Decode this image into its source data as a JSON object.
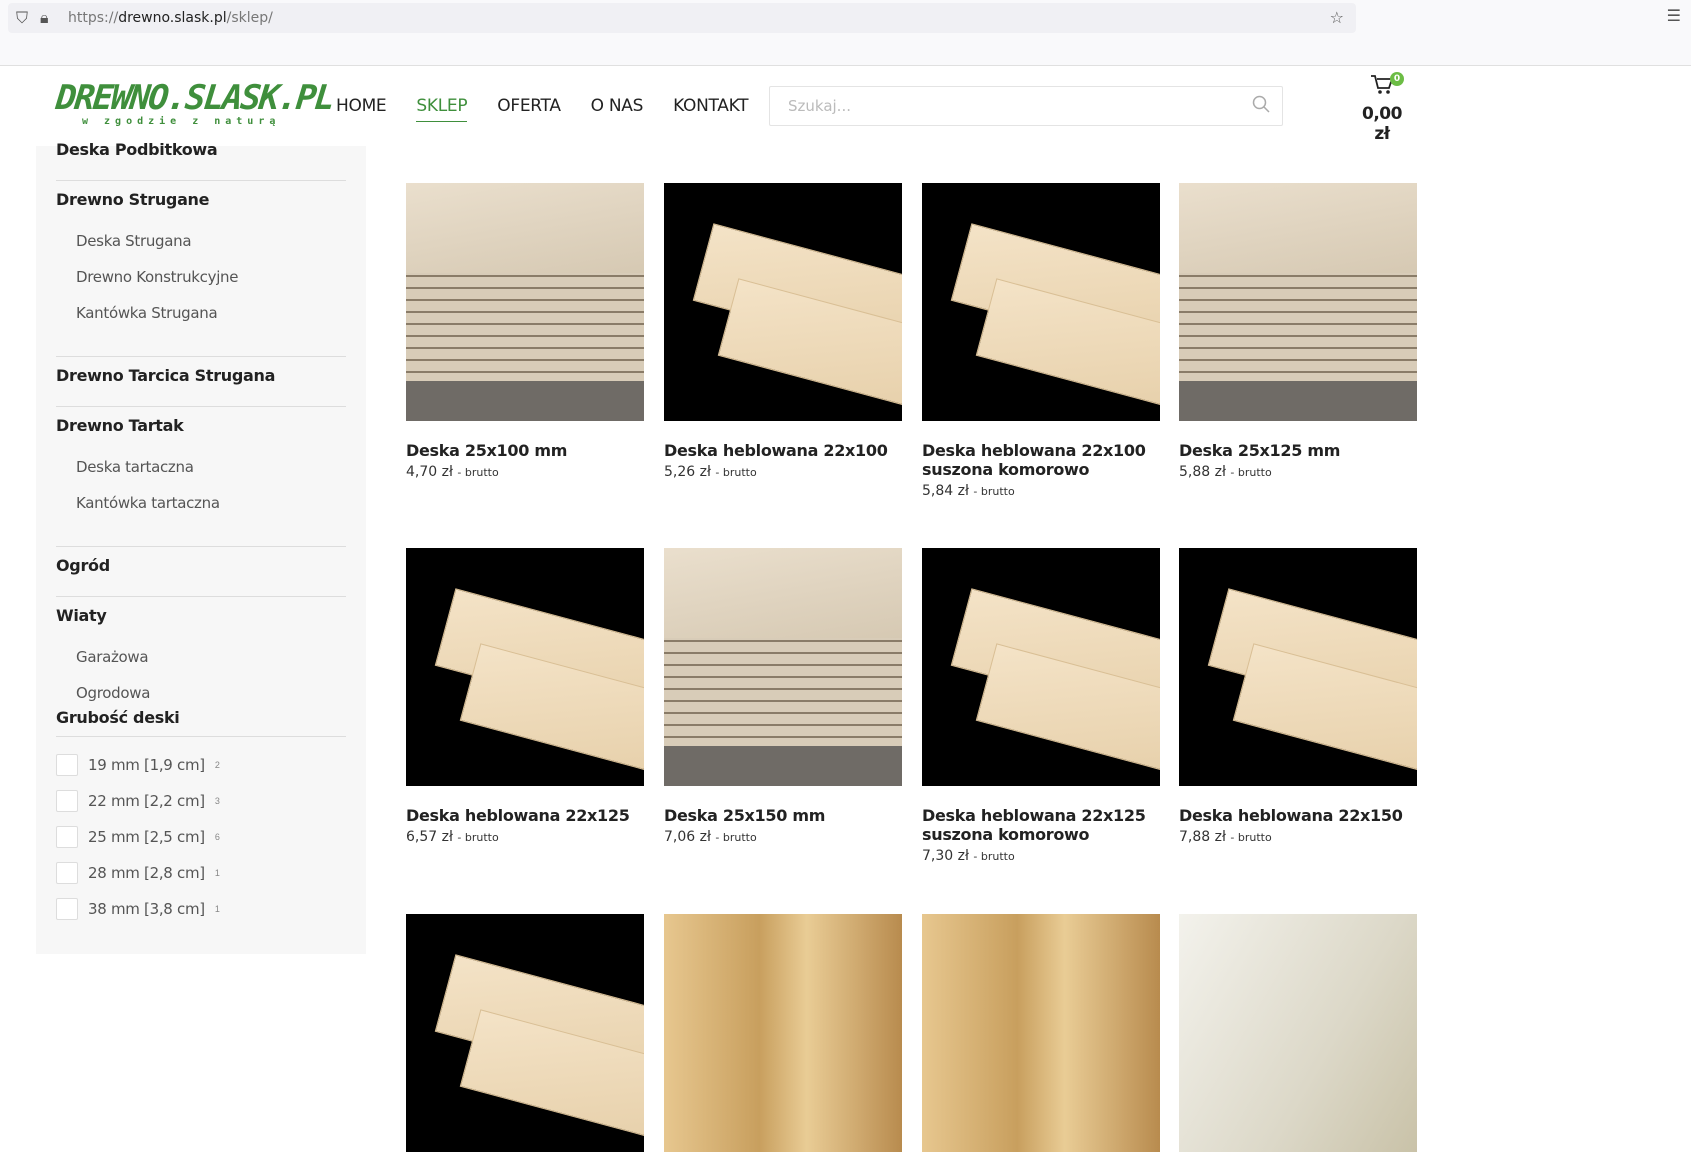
{
  "browser": {
    "url_scheme": "https://",
    "url_host": "drewno.slask.pl",
    "url_path": "/sklep/"
  },
  "header": {
    "logo_main": "DREWNO.SLASK.PL",
    "logo_tagline": "w zgodzie z naturą",
    "nav": [
      "HOME",
      "SKLEP",
      "OFERTA",
      "O NAS",
      "KONTAKT"
    ],
    "active_nav": "SKLEP",
    "search_placeholder": "Szukaj...",
    "cart_count": "0",
    "cart_total": "0,00 zł"
  },
  "sidebar": {
    "categories": [
      {
        "label": "Deska Podbitkowa",
        "subs": []
      },
      {
        "label": "Drewno Strugane",
        "subs": [
          "Deska Strugana",
          "Drewno Konstrukcyjne",
          "Kantówka Strugana"
        ]
      },
      {
        "label": "Drewno Tarcica Strugana",
        "subs": []
      },
      {
        "label": "Drewno Tartak",
        "subs": [
          "Deska tartaczna",
          "Kantówka tartaczna"
        ]
      },
      {
        "label": "Ogród",
        "subs": []
      },
      {
        "label": "Wiaty",
        "subs": [
          "Garażowa",
          "Ogrodowa"
        ]
      }
    ],
    "filter_title": "Grubość deski",
    "filters": [
      {
        "label": "19 mm [1,9 cm]",
        "count": "2"
      },
      {
        "label": "22 mm [2,2 cm]",
        "count": "3"
      },
      {
        "label": "25 mm [2,5 cm]",
        "count": "6"
      },
      {
        "label": "28 mm [2,8 cm]",
        "count": "1"
      },
      {
        "label": "38 mm [3,8 cm]",
        "count": "1"
      }
    ]
  },
  "products": [
    {
      "title": "Deska 25x100 mm",
      "price": "4,70 zł",
      "suffix": "- brutto",
      "image": "stack"
    },
    {
      "title": "Deska heblowana 22x100",
      "price": "5,26 zł",
      "suffix": "- brutto",
      "image": "black"
    },
    {
      "title": "Deska heblowana 22x100 suszona komorowo",
      "price": "5,84 zł",
      "suffix": "- brutto",
      "image": "black"
    },
    {
      "title": "Deska 25x125 mm",
      "price": "5,88 zł",
      "suffix": "- brutto",
      "image": "stack"
    },
    {
      "title": "Deska heblowana 22x125",
      "price": "6,57 zł",
      "suffix": "- brutto",
      "image": "black"
    },
    {
      "title": "Deska 25x150 mm",
      "price": "7,06 zł",
      "suffix": "- brutto",
      "image": "stack"
    },
    {
      "title": "Deska heblowana 22x125 suszona komorowo",
      "price": "7,30 zł",
      "suffix": "- brutto",
      "image": "black"
    },
    {
      "title": "Deska heblowana 22x150",
      "price": "7,88 zł",
      "suffix": "- brutto",
      "image": "black"
    },
    {
      "title": "",
      "price": "",
      "suffix": "",
      "image": "black"
    },
    {
      "title": "",
      "price": "",
      "suffix": "",
      "image": "wood"
    },
    {
      "title": "",
      "price": "",
      "suffix": "",
      "image": "wood"
    },
    {
      "title": "",
      "price": "",
      "suffix": "",
      "image": "light"
    }
  ]
}
